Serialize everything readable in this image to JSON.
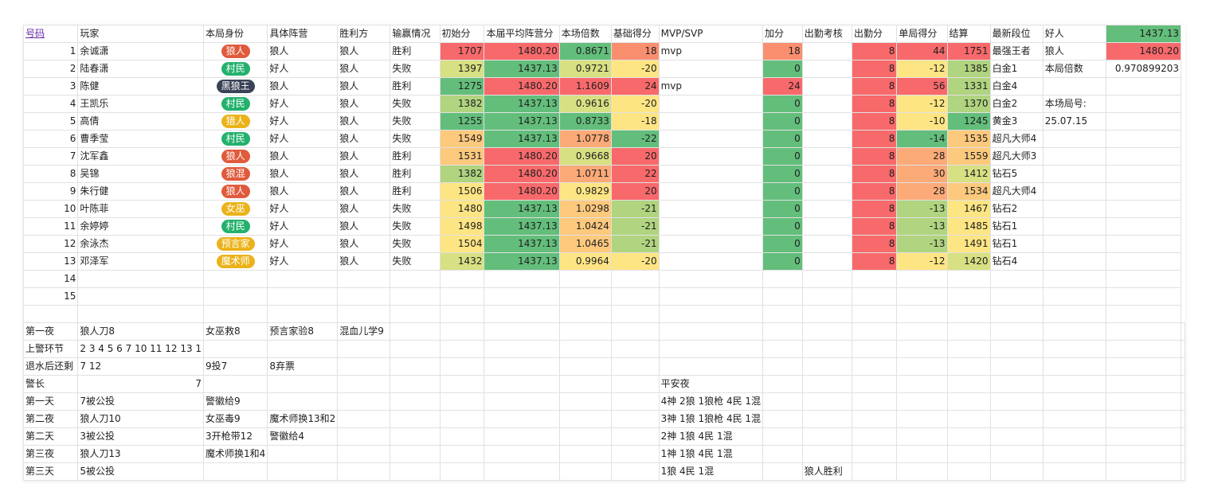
{
  "colors": {
    "wolf": "#e05a3c",
    "villager": "#23b16c",
    "blackwolf": "#3a4356",
    "hunter": "#ebb21a",
    "witch": "#ebb21a",
    "seer": "#ebb21a",
    "magician": "#ebb21a"
  },
  "headers": [
    "号码",
    "玩家",
    "本局身份",
    "具体阵营",
    "胜利方",
    "输赢情况",
    "初始分",
    "本届平均阵营分",
    "本场倍数",
    "基础得分",
    "MVP/SVP",
    "加分",
    "出勤考核",
    "出勤分",
    "单局得分",
    "结算",
    "最新段位"
  ],
  "side": {
    "good_label": "好人",
    "good_value": "1437.13",
    "wolf_label": "狼人",
    "wolf_value": "1480.20",
    "mult_label": "本局倍数",
    "mult_value": "0.970899203",
    "game_no_label": "本场局号:",
    "game_no_value": "25.07.15"
  },
  "rows": [
    {
      "no": "1",
      "player": "余诚潇",
      "role": "狼人",
      "role_color": "wolf",
      "camp": "狼人",
      "winner": "狼人",
      "result": "胜利",
      "init": "1707",
      "avg": "1480.20",
      "mult": "0.8671",
      "base": "18",
      "mvp": "mvp",
      "bonus": "18",
      "attend": "8",
      "single": "44",
      "settle": "1751",
      "rank": "最强王者"
    },
    {
      "no": "2",
      "player": "陆春潇",
      "role": "村民",
      "role_color": "villager",
      "camp": "好人",
      "winner": "狼人",
      "result": "失败",
      "init": "1397",
      "avg": "1437.13",
      "mult": "0.9721",
      "base": "-20",
      "mvp": "",
      "bonus": "0",
      "attend": "8",
      "single": "-12",
      "settle": "1385",
      "rank": "白金1"
    },
    {
      "no": "3",
      "player": "陈健",
      "role": "黑狼王",
      "role_color": "blackwolf",
      "camp": "狼人",
      "winner": "狼人",
      "result": "胜利",
      "init": "1275",
      "avg": "1480.20",
      "mult": "1.1609",
      "base": "24",
      "mvp": "mvp",
      "bonus": "24",
      "attend": "8",
      "single": "56",
      "settle": "1331",
      "rank": "白金4"
    },
    {
      "no": "4",
      "player": "王凯乐",
      "role": "村民",
      "role_color": "villager",
      "camp": "好人",
      "winner": "狼人",
      "result": "失败",
      "init": "1382",
      "avg": "1437.13",
      "mult": "0.9616",
      "base": "-20",
      "mvp": "",
      "bonus": "0",
      "attend": "8",
      "single": "-12",
      "settle": "1370",
      "rank": "白金2"
    },
    {
      "no": "5",
      "player": "高倩",
      "role": "猎人",
      "role_color": "hunter",
      "camp": "好人",
      "winner": "狼人",
      "result": "失败",
      "init": "1255",
      "avg": "1437.13",
      "mult": "0.8733",
      "base": "-18",
      "mvp": "",
      "bonus": "0",
      "attend": "8",
      "single": "-10",
      "settle": "1245",
      "rank": "黄金3"
    },
    {
      "no": "6",
      "player": "曹季莹",
      "role": "村民",
      "role_color": "villager",
      "camp": "好人",
      "winner": "狼人",
      "result": "失败",
      "init": "1549",
      "avg": "1437.13",
      "mult": "1.0778",
      "base": "-22",
      "mvp": "",
      "bonus": "0",
      "attend": "8",
      "single": "-14",
      "settle": "1535",
      "rank": "超凡大师4"
    },
    {
      "no": "7",
      "player": "沈军鑫",
      "role": "狼人",
      "role_color": "wolf",
      "camp": "狼人",
      "winner": "狼人",
      "result": "胜利",
      "init": "1531",
      "avg": "1480.20",
      "mult": "0.9668",
      "base": "20",
      "mvp": "",
      "bonus": "0",
      "attend": "8",
      "single": "28",
      "settle": "1559",
      "rank": "超凡大师3"
    },
    {
      "no": "8",
      "player": "吴锦",
      "role": "狼混",
      "role_color": "wolf",
      "camp": "狼人",
      "winner": "狼人",
      "result": "胜利",
      "init": "1382",
      "avg": "1480.20",
      "mult": "1.0711",
      "base": "22",
      "mvp": "",
      "bonus": "0",
      "attend": "8",
      "single": "30",
      "settle": "1412",
      "rank": "钻石5"
    },
    {
      "no": "9",
      "player": "朱行健",
      "role": "狼人",
      "role_color": "wolf",
      "camp": "狼人",
      "winner": "狼人",
      "result": "胜利",
      "init": "1506",
      "avg": "1480.20",
      "mult": "0.9829",
      "base": "20",
      "mvp": "",
      "bonus": "0",
      "attend": "8",
      "single": "28",
      "settle": "1534",
      "rank": "超凡大师4"
    },
    {
      "no": "10",
      "player": "叶陈菲",
      "role": "女巫",
      "role_color": "witch",
      "camp": "好人",
      "winner": "狼人",
      "result": "失败",
      "init": "1480",
      "avg": "1437.13",
      "mult": "1.0298",
      "base": "-21",
      "mvp": "",
      "bonus": "0",
      "attend": "8",
      "single": "-13",
      "settle": "1467",
      "rank": "钻石2"
    },
    {
      "no": "11",
      "player": "余婷婷",
      "role": "村民",
      "role_color": "villager",
      "camp": "好人",
      "winner": "狼人",
      "result": "失败",
      "init": "1498",
      "avg": "1437.13",
      "mult": "1.0424",
      "base": "-21",
      "mvp": "",
      "bonus": "0",
      "attend": "8",
      "single": "-13",
      "settle": "1485",
      "rank": "钻石1"
    },
    {
      "no": "12",
      "player": "余泳杰",
      "role": "预言家",
      "role_color": "seer",
      "camp": "好人",
      "winner": "狼人",
      "result": "失败",
      "init": "1504",
      "avg": "1437.13",
      "mult": "1.0465",
      "base": "-21",
      "mvp": "",
      "bonus": "0",
      "attend": "8",
      "single": "-13",
      "settle": "1491",
      "rank": "钻石1"
    },
    {
      "no": "13",
      "player": "邓泽军",
      "role": "魔术师",
      "role_color": "magician",
      "camp": "好人",
      "winner": "狼人",
      "result": "失败",
      "init": "1432",
      "avg": "1437.13",
      "mult": "0.9964",
      "base": "-20",
      "mvp": "",
      "bonus": "0",
      "attend": "8",
      "single": "-12",
      "settle": "1420",
      "rank": "钻石4"
    }
  ],
  "empty_numbers": [
    "14",
    "15"
  ],
  "log": [
    {
      "label": "第一夜",
      "cells": [
        "狼人刀8",
        "女巫救8",
        "预言家验8",
        "混血儿学9"
      ],
      "mid": "",
      "right": ""
    },
    {
      "label": "上警环节",
      "cells": [
        "2 3 4 5 6 7 10 11 12 13 1",
        "",
        "",
        ""
      ],
      "mid": "",
      "right": ""
    },
    {
      "label": "退水后还剩",
      "cells": [
        "7 12",
        "9投7",
        "8弃票",
        ""
      ],
      "mid": "",
      "right": ""
    },
    {
      "label": "警长",
      "cells": [
        "7",
        "",
        "",
        ""
      ],
      "mid": "平安夜",
      "right": ""
    },
    {
      "label": "第一天",
      "cells": [
        "7被公投",
        "警徽给9",
        "",
        ""
      ],
      "mid": "4神 2狼 1狼枪 4民 1混",
      "right": ""
    },
    {
      "label": "第二夜",
      "cells": [
        "狼人刀10",
        "女巫毒9",
        "魔术师换13和2",
        ""
      ],
      "mid": "3神 1狼 1狼枪 4民 1混",
      "right": ""
    },
    {
      "label": "第二天",
      "cells": [
        "3被公投",
        "3开枪带12",
        "警徽给4",
        ""
      ],
      "mid": "2神 1狼 4民 1混",
      "right": ""
    },
    {
      "label": "第三夜",
      "cells": [
        "狼人刀13",
        "魔术师换1和4",
        "",
        ""
      ],
      "mid": "1神 1狼 4民 1混",
      "right": ""
    },
    {
      "label": "第三天",
      "cells": [
        "5被公投",
        "",
        "",
        ""
      ],
      "mid": "1狼 4民 1混",
      "right": "狼人胜利"
    }
  ]
}
